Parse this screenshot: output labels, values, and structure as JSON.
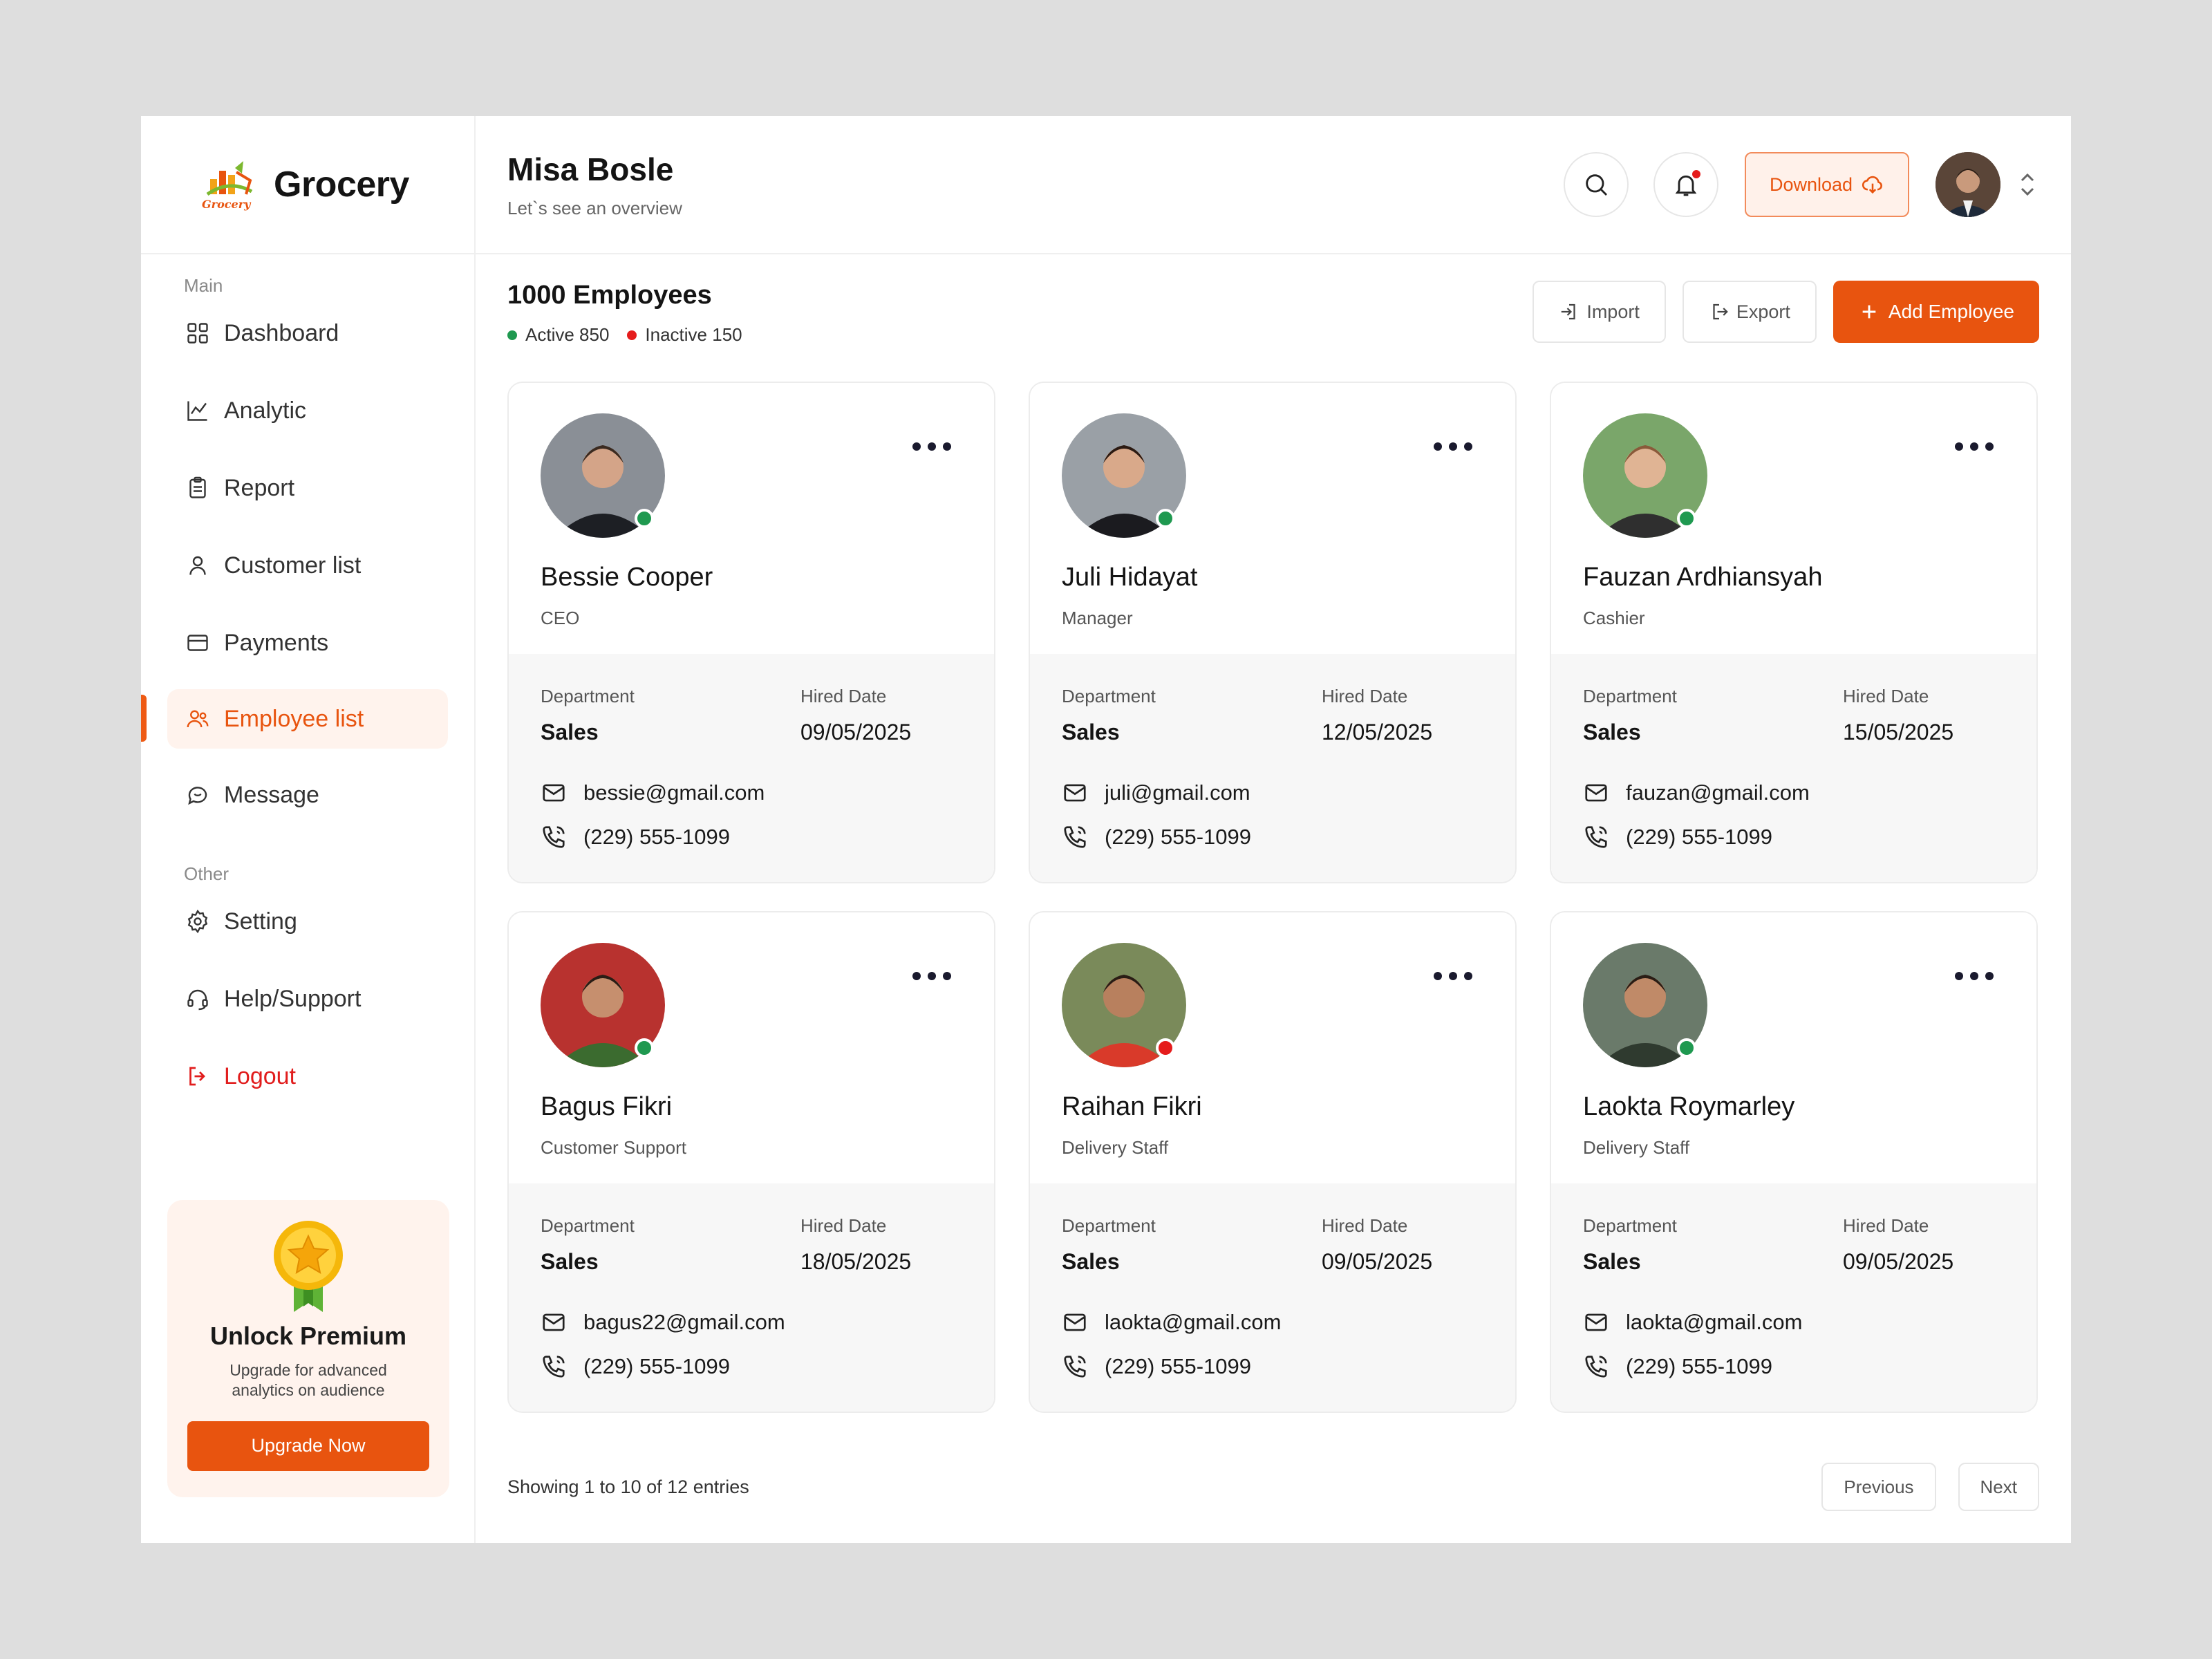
{
  "brand": {
    "name": "Grocery",
    "logo_caption": "Grocery"
  },
  "sidebar": {
    "main_label": "Main",
    "other_label": "Other",
    "items": [
      {
        "label": "Dashboard",
        "icon": "dashboard-icon"
      },
      {
        "label": "Analytic",
        "icon": "chart-icon"
      },
      {
        "label": "Report",
        "icon": "clipboard-icon"
      },
      {
        "label": "Customer list",
        "icon": "user-icon"
      },
      {
        "label": "Payments",
        "icon": "card-icon"
      },
      {
        "label": "Employee list",
        "icon": "users-icon",
        "active": true
      },
      {
        "label": "Message",
        "icon": "chat-icon"
      }
    ],
    "other_items": [
      {
        "label": "Setting",
        "icon": "gear-icon"
      },
      {
        "label": "Help/Support",
        "icon": "headset-icon"
      },
      {
        "label": "Logout",
        "icon": "logout-icon"
      }
    ],
    "premium": {
      "title": "Unlock Premium",
      "description": "Upgrade for advanced analytics on audience",
      "button": "Upgrade Now"
    }
  },
  "header": {
    "name": "Misa Bosle",
    "subtitle": "Let`s see an overview",
    "download_label": "Download"
  },
  "summary": {
    "title": "1000 Employees",
    "active": "Active 850",
    "inactive": "Inactive 150",
    "import_label": "Import",
    "export_label": "Export",
    "add_label": "Add Employee"
  },
  "labels": {
    "department": "Department",
    "hired": "Hired Date"
  },
  "employees": [
    {
      "name": "Bessie Cooper",
      "role": "CEO",
      "department": "Sales",
      "hired": "09/05/2025",
      "email": "bessie@gmail.com",
      "phone": "(229) 555-1099",
      "status": "online"
    },
    {
      "name": "Juli Hidayat",
      "role": "Manager",
      "department": "Sales",
      "hired": "12/05/2025",
      "email": "juli@gmail.com",
      "phone": "(229) 555-1099",
      "status": "online"
    },
    {
      "name": "Fauzan Ardhiansyah",
      "role": "Cashier",
      "department": "Sales",
      "hired": "15/05/2025",
      "email": "fauzan@gmail.com",
      "phone": "(229) 555-1099",
      "status": "online"
    },
    {
      "name": "Bagus Fikri",
      "role": "Customer Support",
      "department": "Sales",
      "hired": "18/05/2025",
      "email": "bagus22@gmail.com",
      "phone": "(229) 555-1099",
      "status": "online"
    },
    {
      "name": "Raihan Fikri",
      "role": "Delivery Staff",
      "department": "Sales",
      "hired": "09/05/2025",
      "email": "laokta@gmail.com",
      "phone": "(229) 555-1099",
      "status": "offline"
    },
    {
      "name": "Laokta Roymarley",
      "role": "Delivery Staff",
      "department": "Sales",
      "hired": "09/05/2025",
      "email": "laokta@gmail.com",
      "phone": "(229) 555-1099",
      "status": "online"
    }
  ],
  "footer": {
    "showing": "Showing 1 to 10 of 12 entries",
    "previous": "Previous",
    "next": "Next"
  },
  "colors": {
    "accent": "#e8540f",
    "online": "#1f9950",
    "offline": "#e51c1c"
  }
}
